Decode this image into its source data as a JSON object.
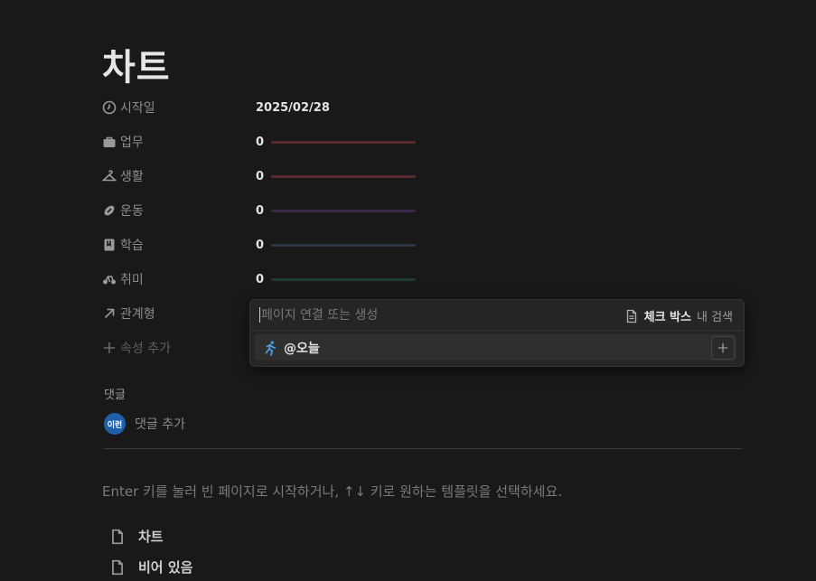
{
  "page": {
    "title": "차트"
  },
  "properties": [
    {
      "icon": "clock-icon",
      "label": "시작일",
      "value": "2025/02/28"
    },
    {
      "icon": "briefcase-icon",
      "label": "업무",
      "value": "0",
      "bar_color": "#5a2a2a"
    },
    {
      "icon": "hanger-icon",
      "label": "생활",
      "value": "0",
      "bar_color": "#5a2a33"
    },
    {
      "icon": "football-icon",
      "label": "운동",
      "value": "0",
      "bar_color": "#3a2a4a"
    },
    {
      "icon": "book-icon",
      "label": "학습",
      "value": "0",
      "bar_color": "#2a3545"
    },
    {
      "icon": "bicycle-icon",
      "label": "취미",
      "value": "0",
      "bar_color": "#1f3a33"
    },
    {
      "icon": "arrow-up-right-icon",
      "label": "관계형"
    },
    {
      "icon": "plus-icon",
      "label": "속성 추가"
    }
  ],
  "relation_popup": {
    "placeholder": "페이지 연결 또는 생성",
    "scope_strong": "체크 박스",
    "scope_suffix": "내 검색",
    "item_label": "@오늘"
  },
  "comments": {
    "heading": "댓글",
    "avatar_text": "이런",
    "add_label": "댓글 추가"
  },
  "empty_hint": "Enter 키를 눌러 빈 페이지로 시작하거나, ↑↓ 키로 원하는 템플릿을 선택하세요.",
  "templates": [
    {
      "label": "차트"
    },
    {
      "label": "비어 있음"
    }
  ]
}
